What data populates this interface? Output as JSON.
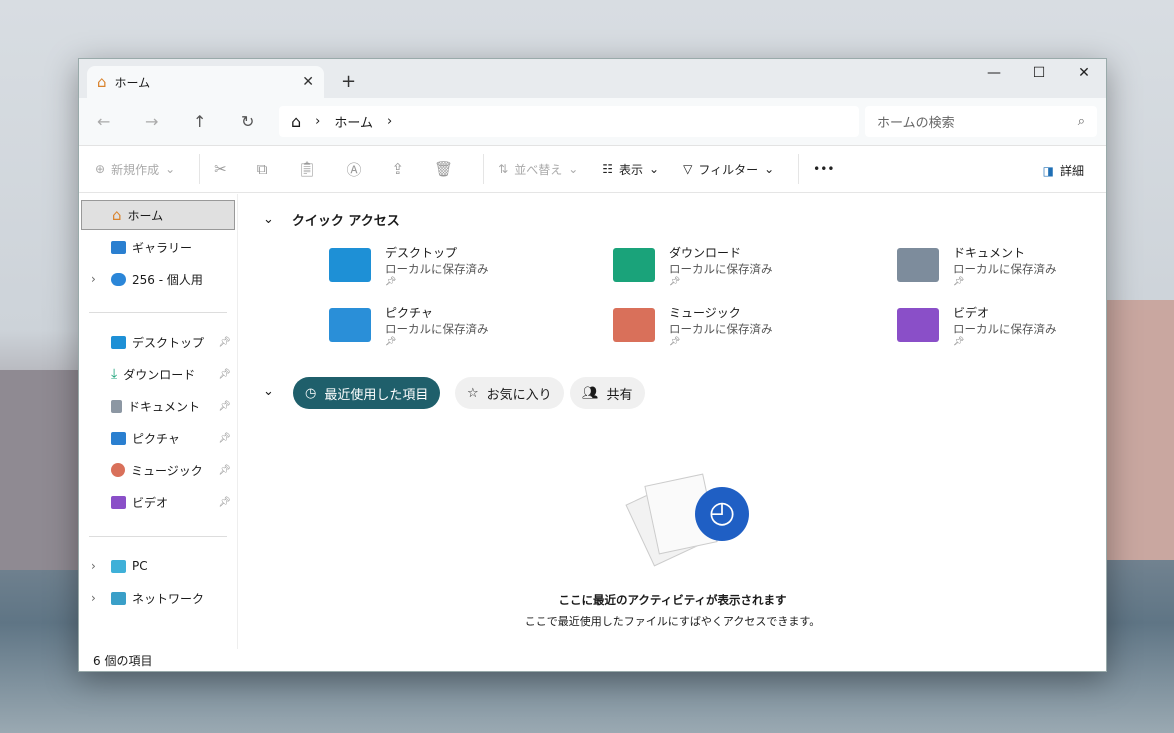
{
  "tab": {
    "title": "ホーム",
    "close": "✕",
    "new": "+"
  },
  "window_controls": {
    "minimize": "—",
    "maximize": "☐",
    "close": "✕"
  },
  "address": {
    "crumbs": [
      "ホーム"
    ],
    "search_placeholder": "ホームの検索"
  },
  "toolbar": {
    "new": "新規作成",
    "sort": "並べ替え",
    "view": "表示",
    "filter": "フィルター",
    "more": "•••",
    "details": "詳細"
  },
  "sidebar": {
    "items": [
      {
        "label": "ホーム"
      },
      {
        "label": "ギャラリー"
      },
      {
        "label": "256 - 個人用"
      },
      {
        "label": "デスクトップ"
      },
      {
        "label": "ダウンロード"
      },
      {
        "label": "ドキュメント"
      },
      {
        "label": "ピクチャ"
      },
      {
        "label": "ミュージック"
      },
      {
        "label": "ビデオ"
      },
      {
        "label": "PC"
      },
      {
        "label": "ネットワーク"
      }
    ]
  },
  "quick_access": {
    "title": "クイック アクセス",
    "items": [
      {
        "name": "デスクトップ",
        "sub": "ローカルに保存済み",
        "color": "#1e90d6"
      },
      {
        "name": "ダウンロード",
        "sub": "ローカルに保存済み",
        "color": "#1aa37a"
      },
      {
        "name": "ドキュメント",
        "sub": "ローカルに保存済み",
        "color": "#7d8c9c"
      },
      {
        "name": "ピクチャ",
        "sub": "ローカルに保存済み",
        "color": "#2a8fd8"
      },
      {
        "name": "ミュージック",
        "sub": "ローカルに保存済み",
        "color": "#d9705a"
      },
      {
        "name": "ビデオ",
        "sub": "ローカルに保存済み",
        "color": "#8a4fc8"
      }
    ]
  },
  "recent_tabs": [
    "最近使用した項目",
    "お気に入り",
    "共有"
  ],
  "empty": {
    "title": "ここに最近のアクティビティが表示されます",
    "sub": "ここで最近使用したファイルにすばやくアクセスできます。"
  },
  "status": "6 個の項目"
}
